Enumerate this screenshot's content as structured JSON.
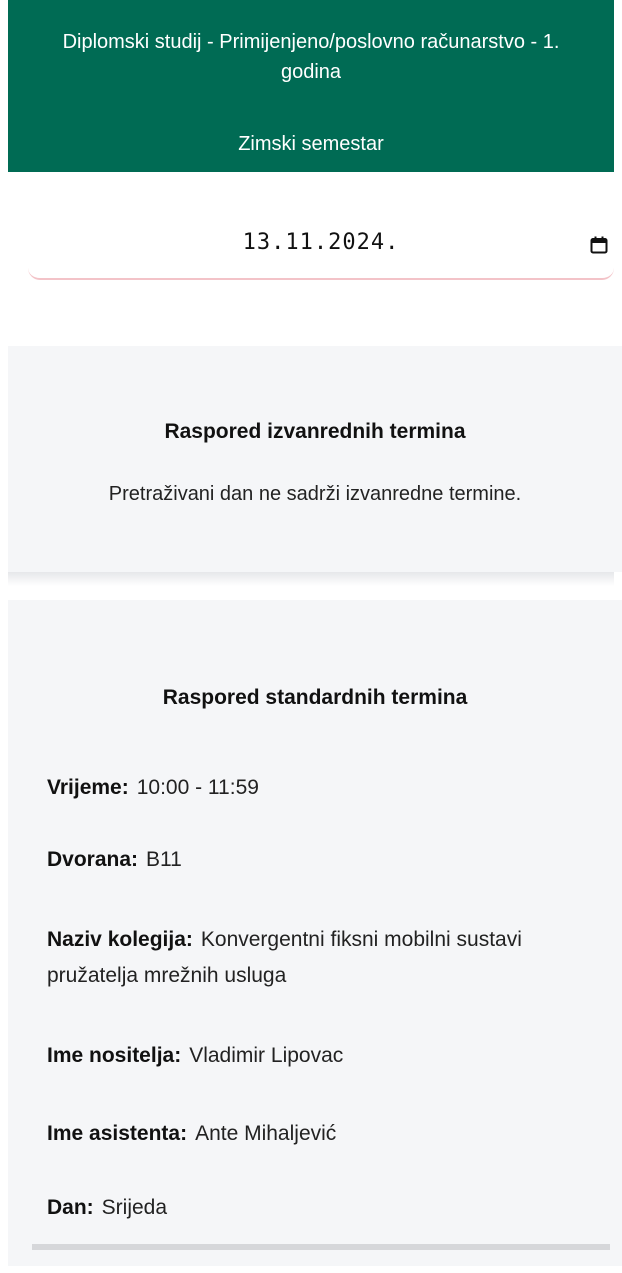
{
  "header": {
    "program": "Diplomski studij - Primijenjeno/poslovno računarstvo - 1. godina",
    "semester": "Zimski semestar"
  },
  "date_picker": {
    "value": "13.11.2024.",
    "icon": "calendar-icon"
  },
  "extra_schedule": {
    "title": "Raspored izvanrednih termina",
    "message": "Pretraživani dan ne sadrži izvanredne termine."
  },
  "standard_schedule": {
    "title": "Raspored standardnih termina",
    "items": [
      {
        "label": "Vrijeme:",
        "value": "10:00 - 11:59"
      },
      {
        "label": "Dvorana:",
        "value": "B11"
      },
      {
        "label": "Naziv kolegija:",
        "value": "Konvergentni fiksni mobilni sustavi pružatelja mrežnih usluga"
      },
      {
        "label": "Ime nositelja:",
        "value": "Vladimir Lipovac"
      },
      {
        "label": "Ime asistenta:",
        "value": "Ante Mihaljević"
      },
      {
        "label": "Dan:",
        "value": "Srijeda"
      }
    ]
  },
  "colors": {
    "header_bg": "#006b54",
    "card_bg": "#f5f6f8",
    "date_underline": "#f3c3c8"
  }
}
